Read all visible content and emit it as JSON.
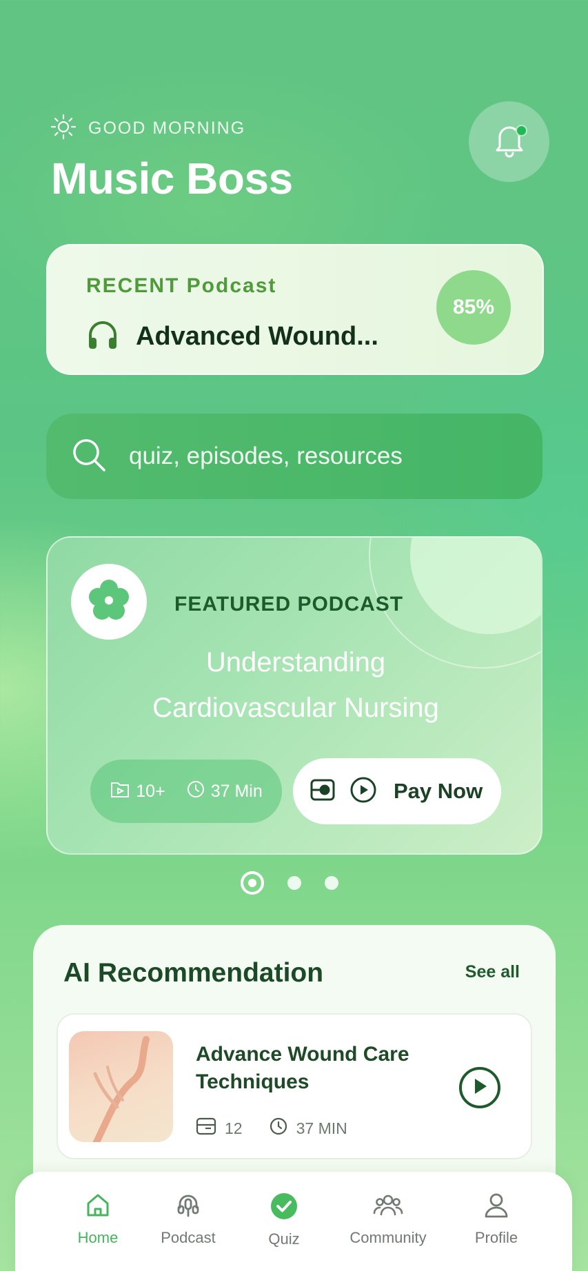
{
  "header": {
    "greeting": "GOOD MORNING",
    "user_name": "Music Boss",
    "greeting_icon": "sun-icon",
    "notification_icon": "bell-icon",
    "has_unread": true
  },
  "recent": {
    "label": "RECENT Podcast",
    "title": "Advanced Wound...",
    "progress_text": "85%",
    "progress": 0.85,
    "icon": "headphones-icon"
  },
  "search": {
    "placeholder": "quiz, episodes, resources",
    "icon": "search-icon"
  },
  "featured": {
    "label": "FEATURED PODCAST",
    "title_line1": "Understanding",
    "title_line2": "Cardiovascular Nursing",
    "episodes": "10+",
    "duration": "37 Min",
    "pay_label": "Pay Now",
    "carousel": {
      "count": 3,
      "active_index": 0
    }
  },
  "ai": {
    "title": "AI Recommendation",
    "see_all": "See all",
    "item": {
      "title": "Advance Wound Care Techniques",
      "episodes": "12",
      "duration": "37 MIN"
    }
  },
  "nav": {
    "items": [
      {
        "label": "Home",
        "icon": "home-icon",
        "active": true
      },
      {
        "label": "Podcast",
        "icon": "podcast-icon",
        "active": false
      },
      {
        "label": "Quiz",
        "icon": "quiz-check-icon",
        "active": false
      },
      {
        "label": "Community",
        "icon": "community-icon",
        "active": false
      },
      {
        "label": "Profile",
        "icon": "profile-icon",
        "active": false
      }
    ]
  },
  "colors": {
    "accent": "#46b45c",
    "dark_green": "#1c4a27",
    "recent_label": "#4f9a3a"
  }
}
